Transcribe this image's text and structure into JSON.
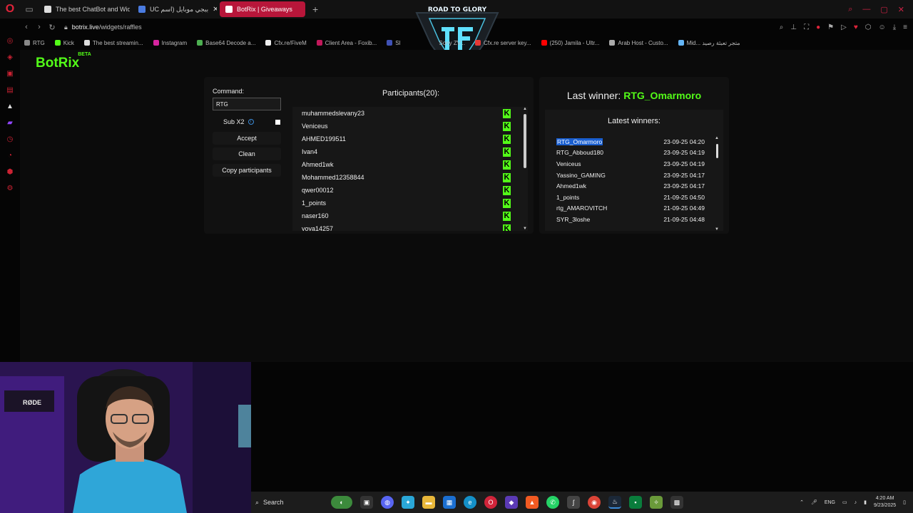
{
  "browser": {
    "tabs": [
      {
        "title": "The best ChatBot and Wid"
      },
      {
        "title": "UC ببجي موبايل (اسم"
      },
      {
        "title": "BotRix | Giveaways"
      }
    ],
    "url_domain": "botrix.live",
    "url_path": "/widgets/raffles",
    "bookmarks": [
      "RTG",
      "Kick",
      "The best streamin...",
      "Instagram",
      "Base64 Decode a...",
      "Cfx.re/FiveM",
      "Client Area - Foxib...",
      "Sl",
      "Sony ZV...",
      "Cfx.re server key...",
      "(250) Jamila - Ultr...",
      "Arab Host - Custo...",
      "Mid... متجر تعبئة رصيد"
    ],
    "overlay_logo_text": "ROAD TO GLORY"
  },
  "app": {
    "brand": "BotRix",
    "brand_badge": "BETA",
    "command_label": "Command:",
    "command_value": "RTG",
    "sub_label": "Sub X2",
    "accept_label": "Accept",
    "clean_label": "Clean",
    "copy_label": "Copy participants",
    "participants_title": "Participants(20):",
    "participants": [
      "muhammedslevany23",
      "Veniceus",
      "AHMED199511",
      "Ivan4",
      "Ahmed1wk",
      "Mohammed12358844",
      "qwer00012",
      "1_points",
      "naser160",
      "yoya14257"
    ],
    "last_winner_label": "Last winner:",
    "last_winner": "RTG_Omarmoro",
    "latest_winners_title": "Latest winners:",
    "latest_winners": [
      {
        "name": "RTG_Omarmoro",
        "time": "23-09-25 04:20"
      },
      {
        "name": "RTG_Abboud180",
        "time": "23-09-25 04:19"
      },
      {
        "name": "Veniceus",
        "time": "23-09-25 04:19"
      },
      {
        "name": "Yassino_GAMING",
        "time": "23-09-25 04:17"
      },
      {
        "name": "Ahmed1wk",
        "time": "23-09-25 04:17"
      },
      {
        "name": "1_points",
        "time": "21-09-25 04:50"
      },
      {
        "name": "rtg_AMAROVITCH",
        "time": "21-09-25 04:49"
      },
      {
        "name": "SYR_3loshe",
        "time": "21-09-25 04:48"
      }
    ]
  },
  "webcam": {
    "mic_brand": "RØDE"
  },
  "taskbar": {
    "search_placeholder": "Search",
    "language": "ENG",
    "time": "4:20 AM",
    "date": "9/23/2025"
  },
  "colors": {
    "accent_green": "#53fc18",
    "tab_active": "#b8163a",
    "opera_red": "#e0243a"
  }
}
